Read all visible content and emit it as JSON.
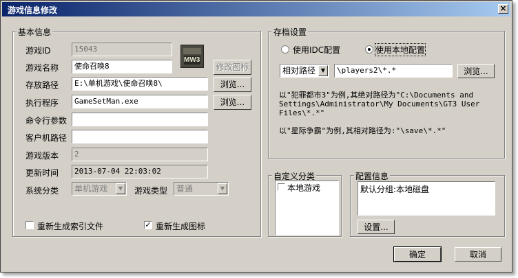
{
  "window": {
    "title": "游戏信息修改",
    "close_glyph": "×"
  },
  "basic": {
    "group_label": "基本信息",
    "game_id_label": "游戏ID",
    "game_id_value": "15043",
    "game_name_label": "游戏名称",
    "game_name_value": "使命召唤8",
    "modify_icon_label": "修改图标",
    "path_label": "存放路径",
    "path_value": "E:\\单机游戏\\使命召唤8\\",
    "browse_label": "浏览...",
    "exe_label": "执行程序",
    "exe_value": "GameSetMan.exe",
    "cmd_label": "命令行参数",
    "cmd_value": "",
    "client_path_label": "客户机路径",
    "client_path_value": "",
    "version_label": "游戏版本",
    "version_value": "2",
    "update_time_label": "更新时间",
    "update_time_value": "2013-07-04 22:03:02",
    "sys_class_label": "系统分类",
    "sys_class_value": "单机游戏",
    "game_type_label": "游戏类型",
    "game_type_value": "普通",
    "regen_index_label": "重新生成索引文件",
    "regen_index_checked": false,
    "regen_icon_label": "重新生成图标",
    "regen_icon_checked": true,
    "icon_art": "MW3"
  },
  "archive": {
    "group_label": "存档设置",
    "idc_label": "使用IDC配置",
    "local_label": "使用本地配置",
    "selected": "local",
    "path_type_value": "相对路径",
    "path_value": "\\players2\\*.*",
    "browse_label": "浏览...",
    "note1": "以\"犯罪都市3\"为例,其绝对路径为\"C:\\Documents and\nSettings\\Administrator\\My Documents\\GT3 User\nFiles\\*.*\"",
    "note2": "以\"星际争霸\"为例,其相对路径为:\"\\save\\*.*\""
  },
  "custom": {
    "group_label": "自定义分类",
    "items": [
      {
        "label": "本地游戏",
        "checked": false
      }
    ]
  },
  "config": {
    "group_label": "配置信息",
    "content": "默认分组:本地磁盘",
    "settings_label": "设置..."
  },
  "footer": {
    "ok_label": "确定",
    "cancel_label": "取消"
  },
  "check_glyph": "✓"
}
